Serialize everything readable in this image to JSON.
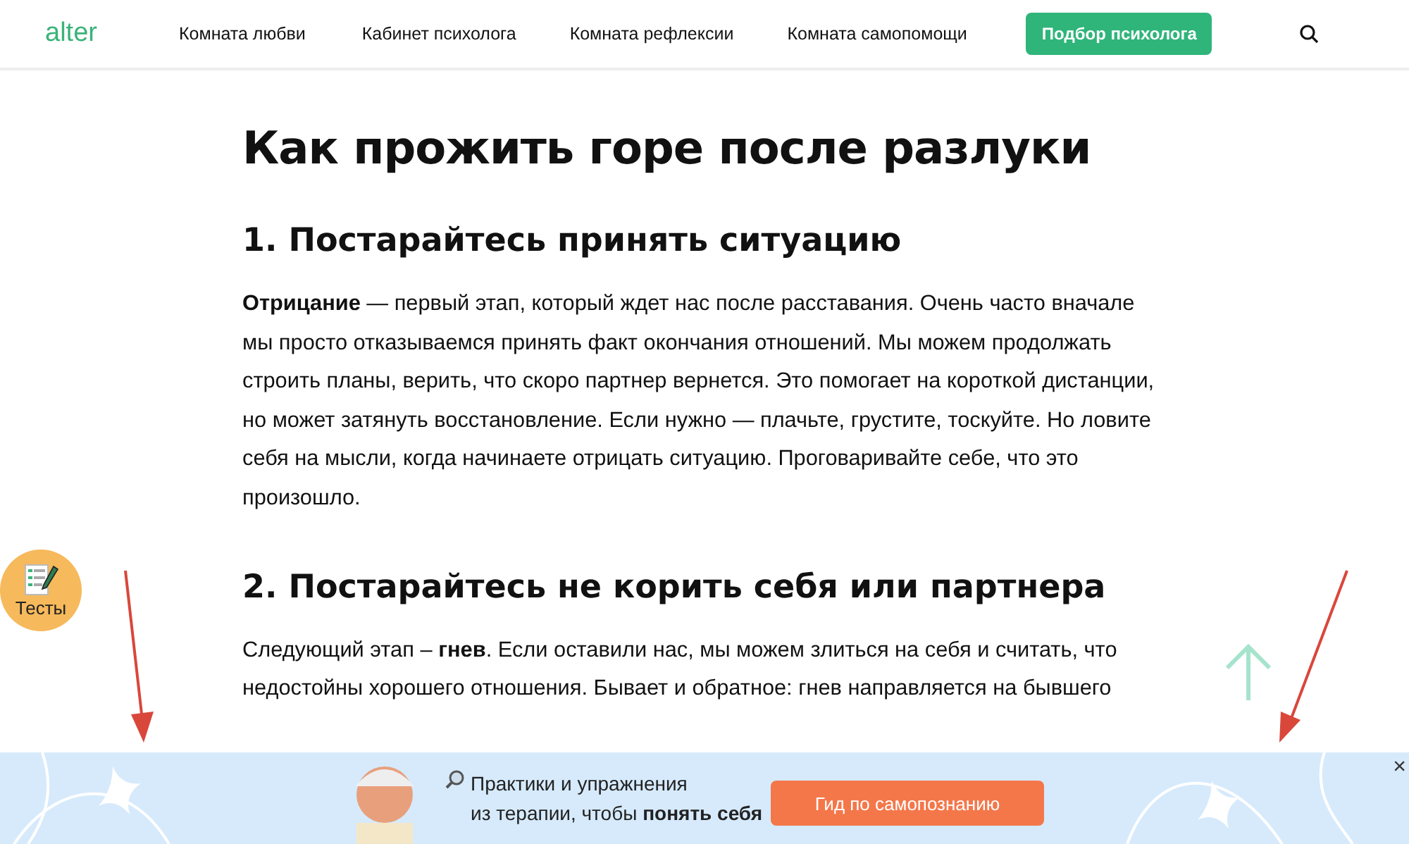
{
  "header": {
    "logo": "alter",
    "nav": [
      {
        "label": "Комната любви"
      },
      {
        "label": "Кабинет психолога"
      },
      {
        "label": "Комната рефлексии"
      },
      {
        "label": "Комната самопомощи"
      }
    ],
    "cta": "Подбор психолога"
  },
  "article": {
    "title": "Как прожить горе после разлуки",
    "sections": [
      {
        "heading": "1. Постарайтесь принять ситуацию",
        "text": "**Отрицание** — первый этап, который ждет нас после расставания. Очень часто вначале мы просто отказываемся принять факт окончания отношений. Мы можем продолжать строить планы, верить, что скоро партнер вернется. Это помогает на короткой дистанции, но может затянуть восстановление. Если нужно — плачьте, грустите, тоскуйте. Но ловите себя на мысли, когда начинаете отрицать ситуацию. Проговаривайте себе, что это произошло."
      },
      {
        "heading": "2. Постарайтесь не корить себя или партнера",
        "text": "Следующий этап – **гнев**. Если оставили нас, мы можем злиться на себя и считать, что недостойны хорошего отношения. Бывает и обратное: гнев направляется на бывшего"
      }
    ]
  },
  "tests_badge": "Тесты",
  "banner": {
    "lines": [
      "Практики и упражнения",
      "из терапии, чтобы **понять себя**"
    ],
    "button": "Гид по самопознанию",
    "close": "×"
  }
}
